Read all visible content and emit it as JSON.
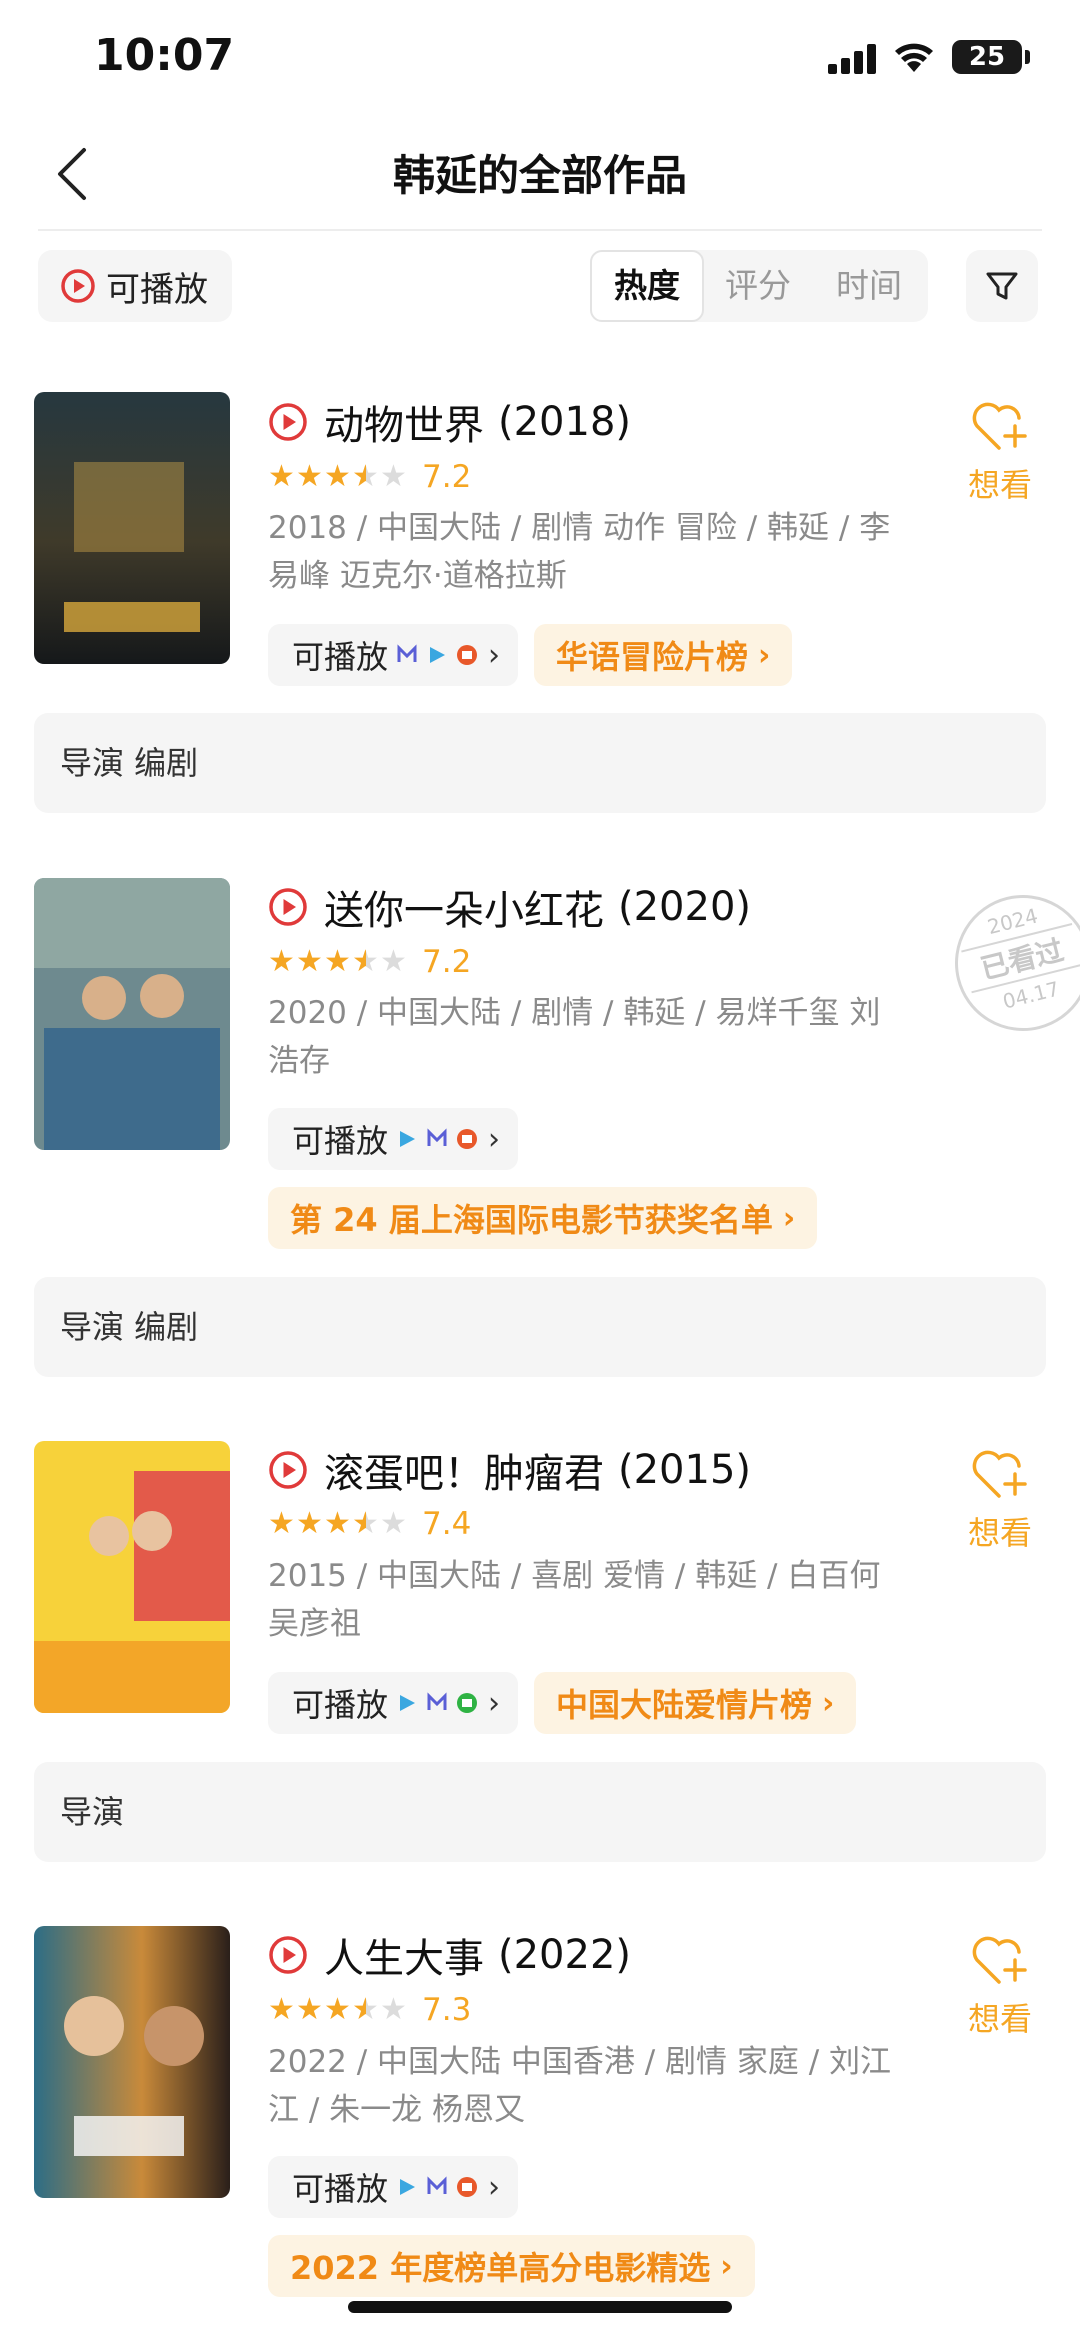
{
  "status": {
    "time": "10:07",
    "battery": "25"
  },
  "nav": {
    "title": "韩延的全部作品"
  },
  "filters": {
    "playable_label": "可播放",
    "sort_tabs": [
      {
        "label": "热度",
        "active": true
      },
      {
        "label": "评分",
        "active": false
      },
      {
        "label": "时间",
        "active": false
      }
    ]
  },
  "items": [
    {
      "title": "动物世界",
      "year": "(2018)",
      "stars": 3.5,
      "score": "7.2",
      "info": "2018 / 中国大陆 / 剧情 动作 冒险 / 韩延 / 李易峰 迈克尔·道格拉斯",
      "play_label": "可播放",
      "rank": "华语冒险片榜",
      "action": "want",
      "want_label": "想看",
      "role": "导演 编剧"
    },
    {
      "title": "送你一朵小红花",
      "year": "(2020)",
      "stars": 3.5,
      "score": "7.2",
      "info": "2020 / 中国大陆 / 剧情 / 韩延 / 易烊千玺 刘浩存",
      "play_label": "可播放",
      "rank": "第 24 届上海国际电影节获奖名单",
      "action": "seen",
      "seen": {
        "year": "2024",
        "text": "已看过",
        "date": "04.17"
      },
      "role": "导演 编剧"
    },
    {
      "title": "滚蛋吧！肿瘤君",
      "year": "(2015)",
      "stars": 3.5,
      "score": "7.4",
      "info": "2015 / 中国大陆 / 喜剧 爱情 / 韩延 / 白百何 吴彦祖",
      "play_label": "可播放",
      "rank": "中国大陆爱情片榜",
      "action": "want",
      "want_label": "想看",
      "role": "导演"
    },
    {
      "title": "人生大事",
      "year": "(2022)",
      "stars": 3.5,
      "score": "7.3",
      "info": "2022 / 中国大陆 中国香港 / 剧情 家庭 / 刘江江 / 朱一龙 杨恩又",
      "play_label": "可播放",
      "rank": "2022 年度榜单高分电影精选",
      "action": "want",
      "want_label": "想看",
      "role": ""
    }
  ],
  "colors": {
    "accent": "#f5a623",
    "play_red": "#e03a3a",
    "rank_bg": "#fdf3e2",
    "rank_text": "#f08a16"
  }
}
